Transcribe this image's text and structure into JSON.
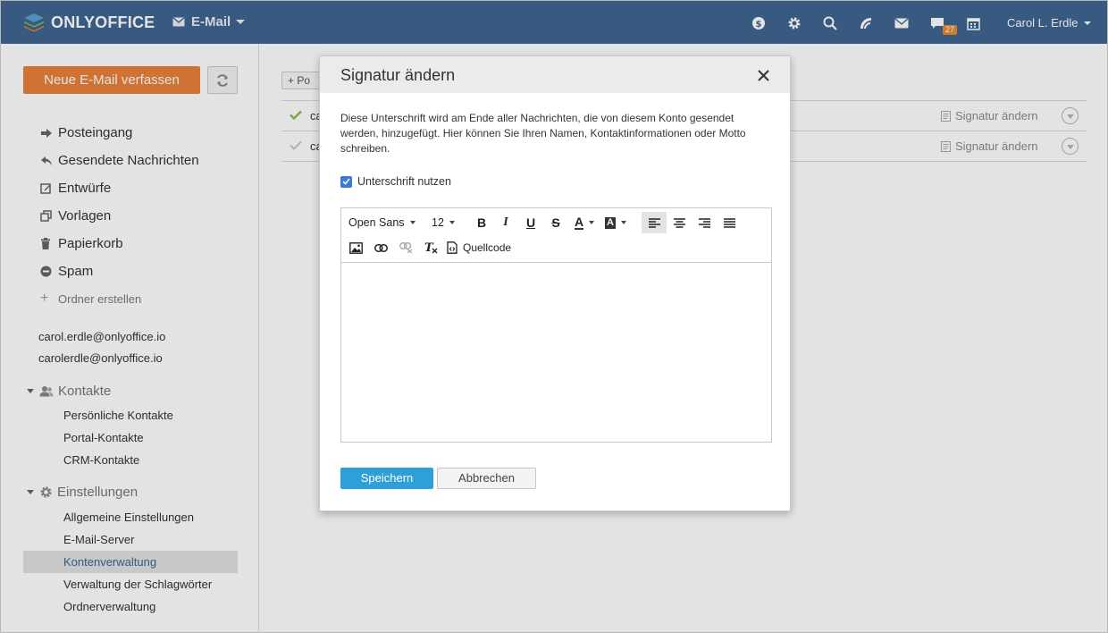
{
  "header": {
    "logo_text": "ONLYOFFICE",
    "module_label": "E-Mail",
    "notification_count": "27",
    "user_name": "Carol L. Erdle",
    "icons": [
      "dollar-icon",
      "gear-icon",
      "search-icon",
      "feed-icon",
      "mail-icon",
      "chat-icon",
      "calendar-icon"
    ]
  },
  "sidebar": {
    "compose_label": "Neue E-Mail verfassen",
    "folders": [
      {
        "label": "Posteingang",
        "icon": "arrow-right-icon"
      },
      {
        "label": "Gesendete Nachrichten",
        "icon": "reply-icon"
      },
      {
        "label": "Entwürfe",
        "icon": "edit-icon"
      },
      {
        "label": "Vorlagen",
        "icon": "copy-icon"
      },
      {
        "label": "Papierkorb",
        "icon": "trash-icon"
      },
      {
        "label": "Spam",
        "icon": "minus-circle-icon"
      }
    ],
    "create_folder_label": "Ordner erstellen",
    "accounts": [
      "carol.erdle@onlyoffice.io",
      "carolerdle@onlyoffice.io"
    ],
    "contacts": {
      "title": "Kontakte",
      "items": [
        "Persönliche Kontakte",
        "Portal-Kontakte",
        "CRM-Kontakte"
      ]
    },
    "settings": {
      "title": "Einstellungen",
      "items": [
        "Allgemeine Einstellungen",
        "E-Mail-Server",
        "Kontenverwaltung",
        "Verwaltung der Schlagwörter",
        "Ordnerverwaltung"
      ],
      "active_index": 2
    }
  },
  "main": {
    "add_label": "+ Po",
    "rows": [
      {
        "name": "ca",
        "signature_label": "Signatur ändern",
        "checked": true
      },
      {
        "name": "ca",
        "signature_label": "Signatur ändern",
        "checked": false
      }
    ]
  },
  "dialog": {
    "title": "Signatur ändern",
    "description": "Diese Unterschrift wird am Ende aller Nachrichten, die von diesem Konto gesendet werden, hinzugefügt. Hier können Sie Ihren Namen, Kontaktinformationen oder Motto schreiben.",
    "use_signature_label": "Unterschrift nutzen",
    "use_signature_checked": true,
    "toolbar": {
      "font_family": "Open Sans",
      "font_size": "12",
      "bold": "B",
      "italic": "I",
      "underline": "U",
      "strike": "S",
      "text_color": "A",
      "bg_color": "A",
      "source_code_label": "Quellcode"
    },
    "save_label": "Speichern",
    "cancel_label": "Abbrechen"
  },
  "colors": {
    "header_bg": "#3f6590",
    "compose_bg": "#e8823a",
    "save_bg": "#2f9fd8",
    "check_green": "#8bba45",
    "checkbox_blue": "#3b7bd5"
  }
}
